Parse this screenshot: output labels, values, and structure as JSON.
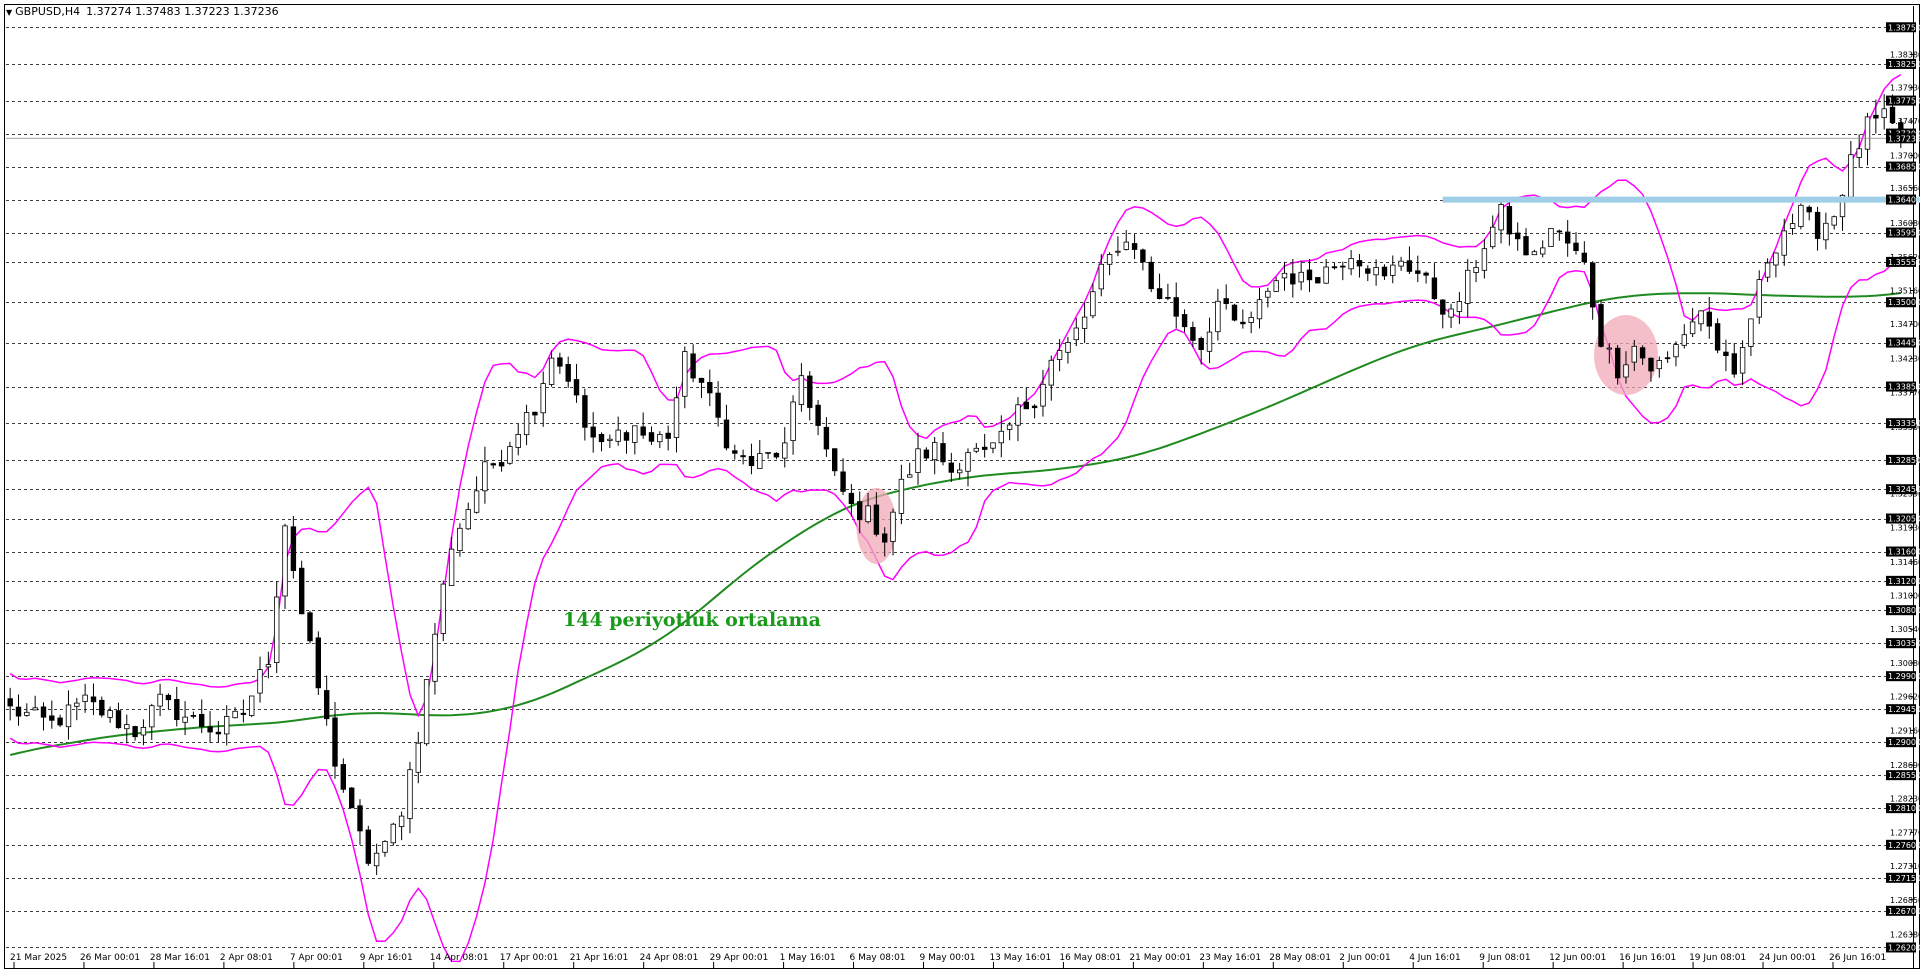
{
  "header": {
    "symbol_timeframe": "GBPUSD,H4",
    "ohlc": "1.37274 1.37483 1.37223 1.37236"
  },
  "annotation": {
    "text": "144 periyotluk ortalama"
  },
  "colors": {
    "background": "#ffffff",
    "candles": "#000000",
    "bollinger": "#ff00ff",
    "moving_average": "#1f8a1f",
    "resistance_line": "#9ecfe6",
    "highlight_circles": "#f2a9b8",
    "grid": "#000000"
  },
  "chart_data": {
    "type": "candlestick",
    "symbol": "GBPUSD",
    "timeframe": "H4",
    "grid": "horizontal dashed at right-axis highlighted levels",
    "ylim": [
      1.2592,
      1.3904
    ],
    "x_ticks": [
      "21 Mar 2025",
      "26 Mar 00:01",
      "28 Mar 16:01",
      "2 Apr 08:01",
      "7 Apr 00:01",
      "9 Apr 16:01",
      "14 Apr 08:01",
      "17 Apr 00:01",
      "21 Apr 16:01",
      "24 Apr 08:01",
      "29 Apr 00:01",
      "1 May 16:01",
      "6 May 08:01",
      "9 May 00:01",
      "13 May 16:01",
      "16 May 08:01",
      "21 May 00:01",
      "23 May 16:01",
      "28 May 08:01",
      "2 Jun 00:01",
      "4 Jun 16:01",
      "9 Jun 08:01",
      "12 Jun 00:01",
      "16 Jun 16:01",
      "19 Jun 08:01",
      "24 Jun 00:01",
      "26 Jun 16:01"
    ],
    "y_axis_plain_labels": [
      "1.38380",
      "1.37930",
      "1.37470",
      "1.37000",
      "1.36560",
      "1.36080",
      "1.35620",
      "1.35160",
      "1.34700",
      "1.34230",
      "1.33770",
      "1.33300",
      "1.32850",
      "1.32390",
      "1.31930",
      "1.31460",
      "1.31000",
      "1.30540",
      "1.30080",
      "1.29620",
      "1.29160",
      "1.28690",
      "1.28230",
      "1.27770",
      "1.27310",
      "1.26850",
      "1.26380",
      "1.25920"
    ],
    "y_axis_highlight_labels": [
      "1.38750",
      "1.38250",
      "1.37750",
      "1.37300",
      "1.37236",
      "1.36850",
      "1.36400",
      "1.35950",
      "1.35550",
      "1.35000",
      "1.34450",
      "1.33850",
      "1.33350",
      "1.32850",
      "1.32450",
      "1.32050",
      "1.31600",
      "1.31200",
      "1.30800",
      "1.30350",
      "1.29900",
      "1.29450",
      "1.29000",
      "1.28550",
      "1.28100",
      "1.27600",
      "1.27150",
      "1.26700",
      "1.26200"
    ],
    "current_price": 1.37236,
    "resistance_level": 1.364,
    "price_path_approx": [
      [
        0,
        1.2945
      ],
      [
        5,
        1.2925
      ],
      [
        9,
        1.2955
      ],
      [
        12,
        1.2935
      ],
      [
        15,
        1.2915
      ],
      [
        18,
        1.2955
      ],
      [
        21,
        1.2935
      ],
      [
        25,
        1.2915
      ],
      [
        28,
        1.294
      ],
      [
        31,
        1.3015
      ],
      [
        33,
        1.32
      ],
      [
        35,
        1.3075
      ],
      [
        37,
        1.2975
      ],
      [
        39,
        1.2875
      ],
      [
        41,
        1.28
      ],
      [
        43,
        1.274
      ],
      [
        45,
        1.2755
      ],
      [
        47,
        1.281
      ],
      [
        49,
        1.291
      ],
      [
        51,
        1.305
      ],
      [
        53,
        1.317
      ],
      [
        55,
        1.322
      ],
      [
        57,
        1.327
      ],
      [
        59,
        1.329
      ],
      [
        61,
        1.333
      ],
      [
        63,
        1.336
      ],
      [
        65,
        1.343
      ],
      [
        67,
        1.34
      ],
      [
        69,
        1.333
      ],
      [
        71,
        1.33
      ],
      [
        73,
        1.332
      ],
      [
        75,
        1.333
      ],
      [
        77,
        1.331
      ],
      [
        79,
        1.332
      ],
      [
        81,
        1.342
      ],
      [
        83,
        1.339
      ],
      [
        85,
        1.334
      ],
      [
        87,
        1.329
      ],
      [
        89,
        1.328
      ],
      [
        91,
        1.329
      ],
      [
        93,
        1.33
      ],
      [
        95,
        1.34
      ],
      [
        97,
        1.333
      ],
      [
        99,
        1.326
      ],
      [
        101,
        1.322
      ],
      [
        103,
        1.321
      ],
      [
        105,
        1.318
      ],
      [
        107,
        1.325
      ],
      [
        109,
        1.329
      ],
      [
        111,
        1.33
      ],
      [
        113,
        1.327
      ],
      [
        115,
        1.33
      ],
      [
        117,
        1.329
      ],
      [
        119,
        1.331
      ],
      [
        121,
        1.335
      ],
      [
        123,
        1.337
      ],
      [
        125,
        1.342
      ],
      [
        127,
        1.344
      ],
      [
        129,
        1.348
      ],
      [
        131,
        1.354
      ],
      [
        133,
        1.358
      ],
      [
        135,
        1.358
      ],
      [
        137,
        1.352
      ],
      [
        139,
        1.35
      ],
      [
        141,
        1.347
      ],
      [
        143,
        1.344
      ],
      [
        145,
        1.35
      ],
      [
        147,
        1.347
      ],
      [
        149,
        1.347
      ],
      [
        151,
        1.352
      ],
      [
        153,
        1.354
      ],
      [
        155,
        1.353
      ],
      [
        157,
        1.354
      ],
      [
        159,
        1.355
      ],
      [
        161,
        1.357
      ],
      [
        163,
        1.355
      ],
      [
        165,
        1.353
      ],
      [
        167,
        1.356
      ],
      [
        169,
        1.354
      ],
      [
        171,
        1.351
      ],
      [
        173,
        1.348
      ],
      [
        175,
        1.353
      ],
      [
        177,
        1.358
      ],
      [
        179,
        1.362
      ],
      [
        181,
        1.358
      ],
      [
        183,
        1.356
      ],
      [
        185,
        1.36
      ],
      [
        187,
        1.358
      ],
      [
        189,
        1.355
      ],
      [
        191,
        1.345
      ],
      [
        193,
        1.341
      ],
      [
        195,
        1.344
      ],
      [
        197,
        1.341
      ],
      [
        199,
        1.342
      ],
      [
        201,
        1.346
      ],
      [
        203,
        1.349
      ],
      [
        205,
        1.344
      ],
      [
        207,
        1.339
      ],
      [
        209,
        1.348
      ],
      [
        211,
        1.356
      ],
      [
        213,
        1.36
      ],
      [
        215,
        1.362
      ],
      [
        217,
        1.36
      ],
      [
        219,
        1.362
      ],
      [
        221,
        1.369
      ],
      [
        223,
        1.374
      ],
      [
        225,
        1.375
      ],
      [
        227,
        1.3724
      ]
    ],
    "bands_note": "Bollinger-style envelope drawn in magenta around price; 144-period moving average drawn in green"
  }
}
